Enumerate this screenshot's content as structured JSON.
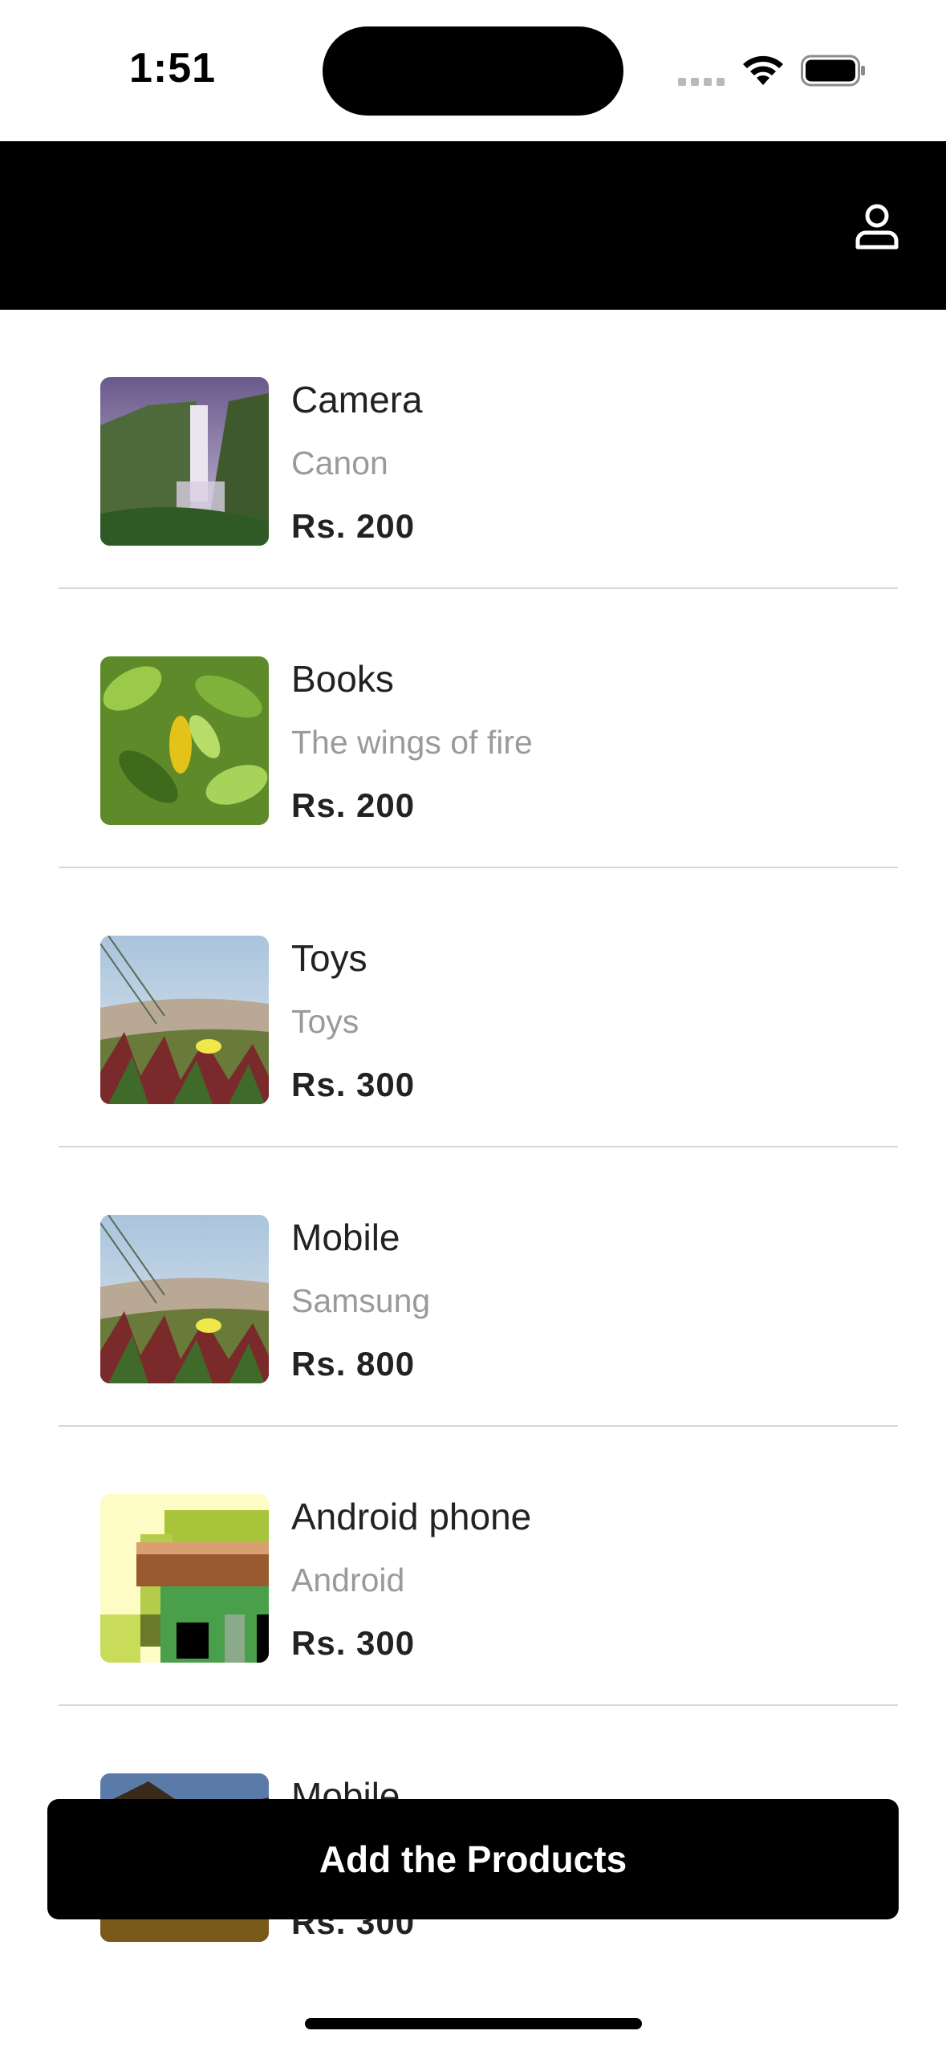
{
  "status_bar": {
    "time": "1:51"
  },
  "header": {
    "profile_icon": "person-icon"
  },
  "products": [
    {
      "name": "Camera",
      "brand": "Canon",
      "price": "Rs. 200",
      "image": "waterfall"
    },
    {
      "name": "Books",
      "brand": "The wings of fire",
      "price": "Rs. 200",
      "image": "leaves"
    },
    {
      "name": "Toys",
      "brand": "Toys",
      "price": "Rs. 300",
      "image": "flower-field"
    },
    {
      "name": "Mobile",
      "brand": "Samsung",
      "price": "Rs. 800",
      "image": "flower-field"
    },
    {
      "name": "Android phone",
      "brand": "Android",
      "price": "Rs. 300",
      "image": "pixel-house"
    },
    {
      "name": "Mobile",
      "brand": "",
      "price": "Rs. 300",
      "image": "rock-landscape"
    }
  ],
  "actions": {
    "add_label": "Add the Products"
  },
  "colors": {
    "header_bg": "#000000",
    "button_bg": "#000000",
    "brand_text": "#9a9a9a",
    "divider": "#d7d7d7"
  }
}
